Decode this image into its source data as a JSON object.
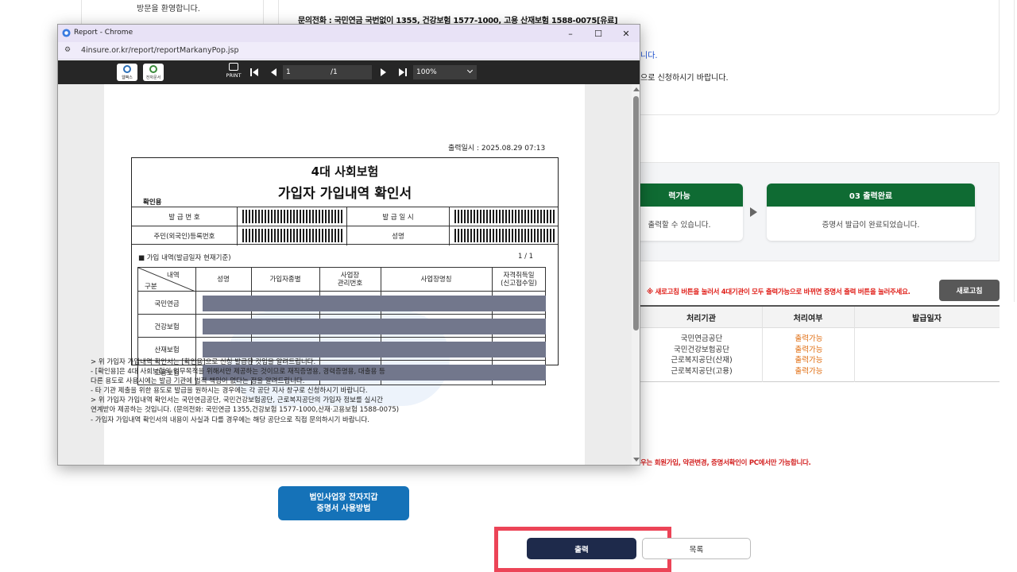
{
  "background": {
    "welcome_text": "방문을 환영합니다.",
    "contact_line": "문의전화 : 국민연금 국번없이 1355, 건강보험 1577-1000, 고용 산재보험 1588-0075[유료]",
    "fragment_blue": "니다.",
    "fragment_apply": "으로 신청하시기 바랍니다.",
    "step2": {
      "header": "력가능",
      "body": "출력할 수 있습니다."
    },
    "step3": {
      "header": "03 출력완료",
      "body": "증명서 발급이 완료되었습니다."
    },
    "refresh_note": "※ 새로고침 버튼을 눌러서 4대기관이 모두 출력가능으로 바뀌면 증명서 출력 버튼을 눌러주세요.",
    "refresh_button": "새로고침",
    "table_headers": [
      "처리기관",
      "처리여부",
      "발급일자"
    ],
    "orgs": [
      "국민연금공단",
      "국민건강보험공단",
      "근로복지공단(산재)",
      "근로복지공단(고용)"
    ],
    "statuses": [
      "출력가능",
      "출력가능",
      "출력가능",
      "출력가능"
    ],
    "mobile_note": "우는 회원가입, 약관변경, 증명서확인이 PC에서만 가능합니다.",
    "ecert_button": [
      "법인사업장 전자지갑",
      "증명서 사용방법"
    ],
    "print_button": "출력",
    "list_button": "목록",
    "colors": {
      "green_header": "#0f6b33",
      "print_btn": "#1e2a4b",
      "ecert_btn": "#1572b8",
      "highlight": "#ec4457",
      "status_orange": "#e06d10"
    }
  },
  "popup": {
    "window_title": "Report - Chrome",
    "url": "4insure.or.kr/report/reportMarkanyPop.jsp",
    "window_controls": [
      "–",
      "☐",
      "✕"
    ],
    "toolbar": {
      "icon1_label": "웹팩스",
      "icon2_label": "전자문서",
      "print_label": "PRINT",
      "page_current": "1",
      "page_total": "/1",
      "zoom": "100%"
    },
    "document": {
      "print_date": "출력일시 : 2025.08.29 07:13",
      "title_line1": "4대 사회보험",
      "title_line2": "가입자 가입내역 확인서",
      "confirm_label": "확인용",
      "issue_no_label": "발 급 번 호",
      "issue_date_label": "발 급 일 시",
      "resident_label": "주민(외국인)등록번호",
      "name_label": "성명",
      "list_title": "■ 가입 내역(발급일자 현재기준)",
      "page_indicator": "1  /  1",
      "col_headers": {
        "diag_top": "내역",
        "diag_bottom": "구분",
        "name": "성명",
        "type": "가입자종별",
        "biz_no": [
          "사업장",
          "관리번호"
        ],
        "biz_name": "사업장명칭",
        "qualify": [
          "자격취득일",
          "(신고접수일)"
        ]
      },
      "rows": [
        "국민연금",
        "건강보험",
        "산재보험",
        "고용보험"
      ],
      "notes": [
        "> 위 가입자 가입내역 확인서는 [확인용]으로 신청 발급된 것임을 알려드립니다.",
        " - [확인용]은 4대 사회보험의 업무목적을 위해서만 제공하는 것이므로 재직증명용, 경력증명용, 대출용 등",
        "   다른 용도로 사용시에는 발급 기관에 법적 책임이 없다는 점을 알려드립니다.",
        " - 타 기관 제출을 위한 용도로 발급을 원하시는 경우에는 각 공단 지사 창구로 신청하시기 바랍니다.",
        "> 위 가입자 가입내역 확인서는 국민연금공단, 국민건강보험공단, 근로복지공단의 가입자 정보를 실시간",
        "   연계받아 제공하는 것입니다. (문의전화: 국민연금 1355,건강보험 1577-1000,산재·고용보험 1588-0075)",
        " - 가입자 가입내역 확인서의 내용이 사실과 다를 경우에는 해당 공단으로 직접 문의하시기 바랍니다."
      ]
    }
  }
}
